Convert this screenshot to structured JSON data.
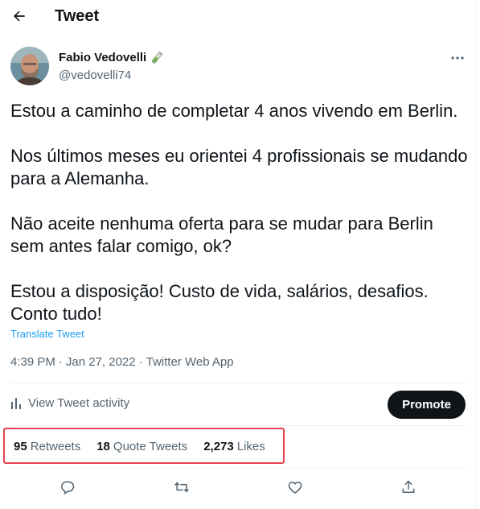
{
  "header": {
    "back_icon": "arrow-left-icon",
    "title": "Tweet"
  },
  "author": {
    "name": "Fabio Vedovelli",
    "handle": "@vedovelli74",
    "badge_icon": "test-tube-emoji-icon"
  },
  "tweet": {
    "paragraphs": [
      "Estou a caminho de completar 4 anos vivendo em Berlin.",
      "Nos últimos meses eu orientei 4 profissionais se mudando para a Alemanha.",
      "Não aceite nenhuma oferta para se mudar para Berlin sem antes falar comigo, ok?",
      "Estou a disposição! Custo de vida, salários, desafios. Conto tudo!"
    ],
    "translate_label": "Translate Tweet"
  },
  "meta": {
    "time": "4:39 PM",
    "separator": "·",
    "date": "Jan 27, 2022",
    "source": "Twitter Web App"
  },
  "activity": {
    "label": "View Tweet activity",
    "promote_label": "Promote"
  },
  "stats": {
    "retweets": {
      "count": "95",
      "label": "Retweets"
    },
    "quote_tweets": {
      "count": "18",
      "label": "Quote Tweets"
    },
    "likes": {
      "count": "2,273",
      "label": "Likes"
    }
  },
  "colors": {
    "accent": "#1d9bf0",
    "text": "#0f1419",
    "muted": "#536471",
    "highlight_border": "#e8404f"
  }
}
